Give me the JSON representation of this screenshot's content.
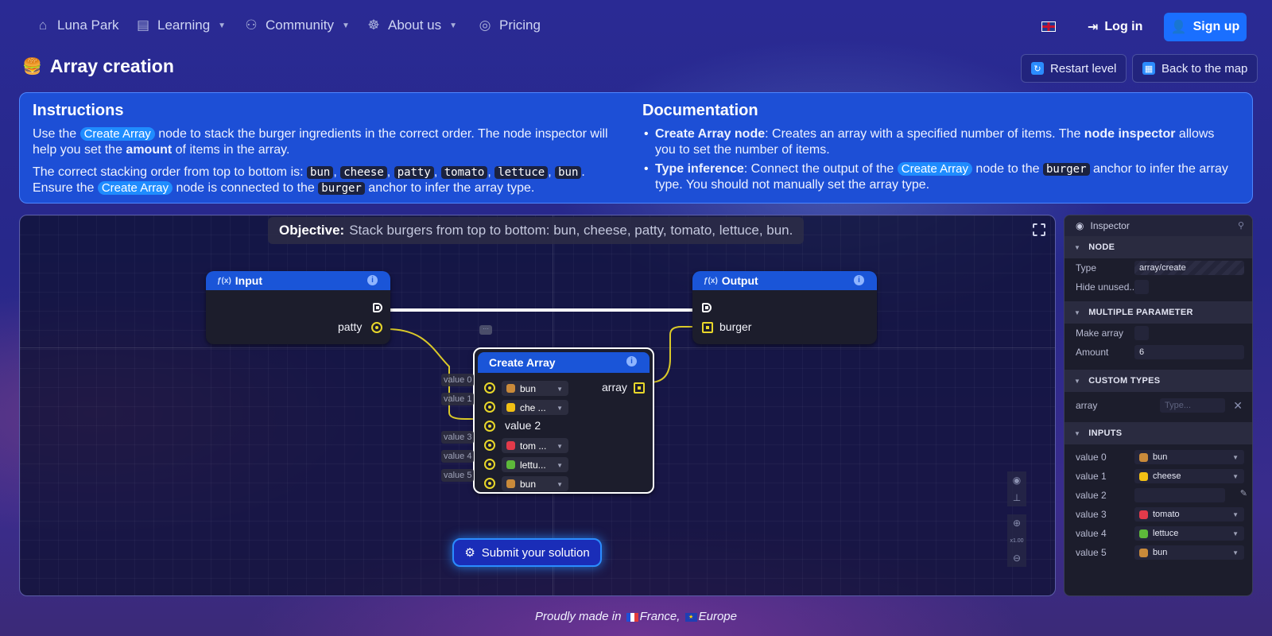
{
  "nav": {
    "items": [
      {
        "label": "Luna Park",
        "icon": "rocket-icon",
        "caret": false
      },
      {
        "label": "Learning",
        "icon": "book-icon",
        "caret": true
      },
      {
        "label": "Community",
        "icon": "people-icon",
        "caret": true
      },
      {
        "label": "About us",
        "icon": "robot-icon",
        "caret": true
      },
      {
        "label": "Pricing",
        "icon": "coin-icon",
        "caret": false
      }
    ],
    "language_flag": "uk-flag-icon",
    "login_label": "Log in",
    "signup_label": "Sign up"
  },
  "page": {
    "title": "Array creation",
    "title_emoji": "🍔",
    "restart_label": "Restart level",
    "back_label": "Back to the map"
  },
  "instructions": {
    "heading": "Instructions",
    "p1_a": "Use the ",
    "p1_pill": "Create Array",
    "p1_b": " node to stack the burger ingredients in the correct order. The node inspector will help you set the ",
    "p1_bold": "amount",
    "p1_c": " of items in the array.",
    "p2_a": "The correct stacking order from top to bottom is: ",
    "order": [
      "bun",
      "cheese",
      "patty",
      "tomato",
      "lettuce",
      "bun"
    ],
    "p2_b": ". Ensure the ",
    "p2_pill": "Create Array",
    "p2_c": " node is connected to the ",
    "p2_code": "burger",
    "p2_d": " anchor to infer the array type."
  },
  "documentation": {
    "heading": "Documentation",
    "b1_bold": "Create Array node",
    "b1_a": ": Creates an array with a specified number of items. The ",
    "b1_bold2": "node inspector",
    "b1_b": " allows you to set the number of items.",
    "b2_bold": "Type inference",
    "b2_a": ": Connect the output of the ",
    "b2_pill": "Create Array",
    "b2_b": " node to the ",
    "b2_code": "burger",
    "b2_c": " anchor to infer the array type. You should not manually set the array type."
  },
  "canvas": {
    "objective_label": "Objective:",
    "objective_text": "Stack burgers from top to bottom: bun, cheese, patty, tomato, lettuce, bun.",
    "input_node": {
      "title": "Input",
      "port": "patty"
    },
    "output_node": {
      "title": "Output",
      "port": "burger"
    },
    "create_node": {
      "title": "Create Array",
      "output": "array",
      "value_tags": [
        "value 0",
        "value 1",
        "value 2",
        "value 3",
        "value 4",
        "value 5"
      ],
      "selects": [
        "bun",
        "che ...",
        "",
        "tom ...",
        "lettu...",
        "bun"
      ],
      "value2_label": "value 2"
    },
    "submit_label": "Submit your solution",
    "zoom_level": "x1.00"
  },
  "inspector": {
    "title": "Inspector",
    "sections": {
      "node": "NODE",
      "multiple": "MULTIPLE PARAMETER",
      "custom": "CUSTOM TYPES",
      "inputs": "INPUTS"
    },
    "type_label": "Type",
    "type_value": "array/create",
    "hide_label": "Hide unused...",
    "make_array_label": "Make array",
    "amount_label": "Amount",
    "amount_value": "6",
    "custom_label": "array",
    "custom_placeholder": "Type...",
    "inputs": [
      {
        "label": "value 0",
        "value": "bun"
      },
      {
        "label": "value 1",
        "value": "cheese"
      },
      {
        "label": "value 2",
        "value": ""
      },
      {
        "label": "value 3",
        "value": "tomato"
      },
      {
        "label": "value 4",
        "value": "lettuce"
      },
      {
        "label": "value 5",
        "value": "bun"
      }
    ]
  },
  "footer": {
    "prefix": "Proudly made in ",
    "country": "France",
    "sep": ", ",
    "region": "Europe"
  },
  "colors": {
    "accent": "#1a6fff",
    "panel": "#1d4fd6",
    "port": "#e8d72a",
    "bun": "#c98a3a",
    "cheese": "#f2c014",
    "tomato": "#e23a4a",
    "lettuce": "#5db83a"
  }
}
